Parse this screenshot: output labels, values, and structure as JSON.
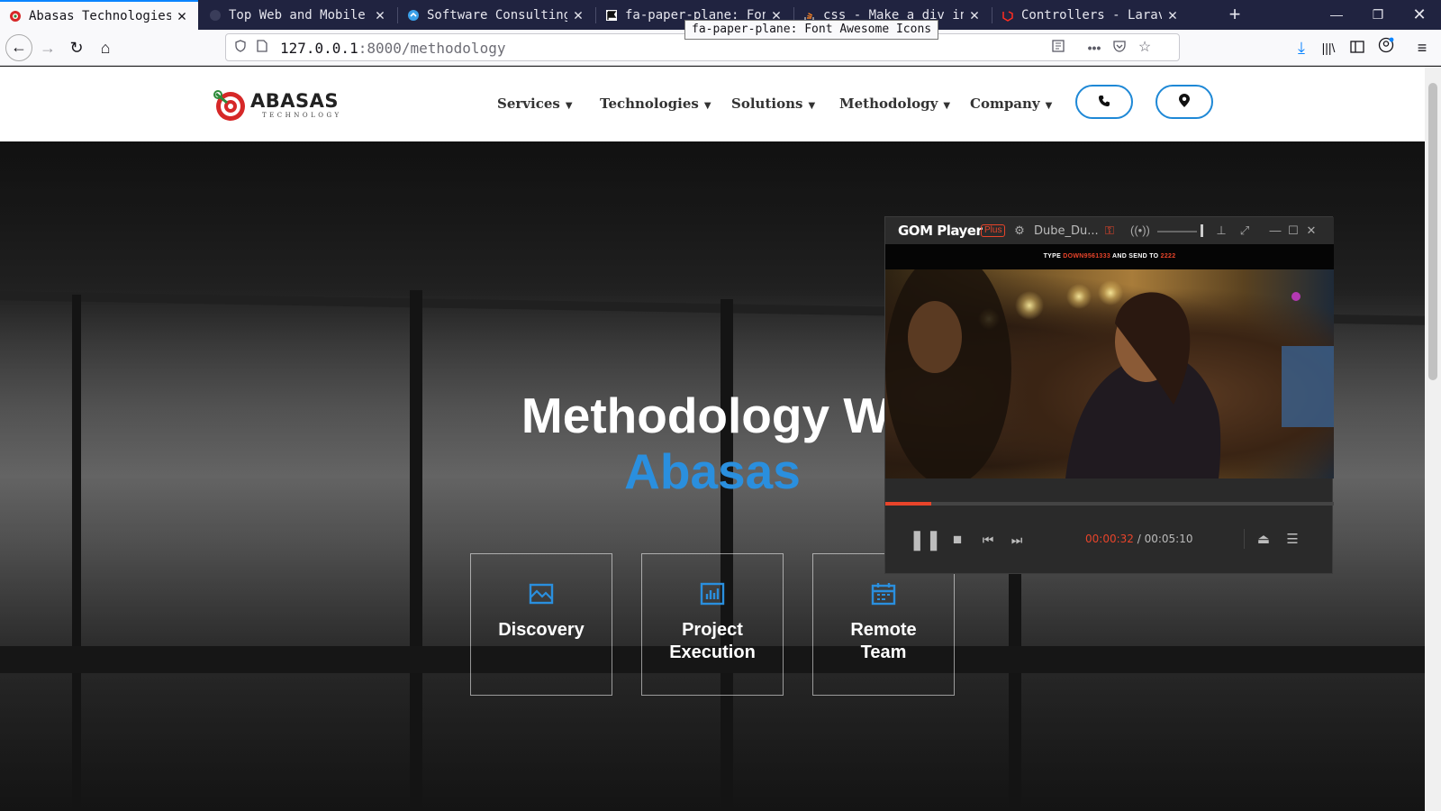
{
  "browser": {
    "tabs": [
      {
        "title": "Abasas Technologies",
        "active": true
      },
      {
        "title": "Top Web and Mobile Ap",
        "active": false
      },
      {
        "title": "Software Consulting",
        "active": false
      },
      {
        "title": "fa-paper-plane: Font ",
        "active": false
      },
      {
        "title": "css - Make a div into",
        "active": false
      },
      {
        "title": "Controllers - Laravel",
        "active": false
      }
    ],
    "tooltip": "fa-paper-plane: Font Awesome Icons",
    "url_host": "127.0.0.1",
    "url_rest": ":8000/methodology"
  },
  "site": {
    "logo_text": "ABASAS",
    "logo_sub": "TECHNOLOGY",
    "menu": [
      {
        "label": "Services"
      },
      {
        "label": "Technologies"
      },
      {
        "label": "Solutions"
      },
      {
        "label": "Methodology"
      },
      {
        "label": "Company"
      }
    ],
    "hero_title": "Methodology Wi",
    "hero_subtitle": "Abasas",
    "cards": [
      {
        "label": "Discovery",
        "icon": "image-icon"
      },
      {
        "label": "Project Execution",
        "icon": "chart-icon"
      },
      {
        "label": "Remote Team",
        "icon": "calendar-icon"
      }
    ]
  },
  "gom": {
    "logo": "GOM Player",
    "plus": "Plus",
    "file": "Dube_Du...",
    "banner_prefix": "TYPE ",
    "banner_code": "DOWN9561333",
    "banner_mid": " AND SEND TO ",
    "banner_number": "2222",
    "current_time": "00:00:32",
    "total_time": "00:05:10",
    "progress_fraction": 0.103,
    "accent": "#e8442a"
  },
  "colors": {
    "brand_blue": "#2a8fde",
    "firefox_accent": "#0a84ff"
  }
}
